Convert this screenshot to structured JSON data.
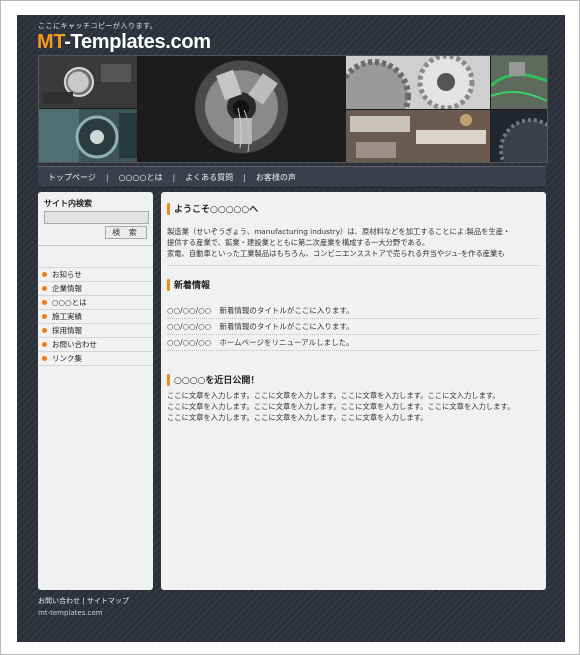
{
  "header": {
    "catch_copy": "ここにキャッチコピーが入ります。",
    "logo_accent": "MT",
    "logo_rest": "-Templates.com",
    "accent_color": "#f39a1d"
  },
  "nav": {
    "items": [
      "トップページ",
      "○○○○とは",
      "よくある質問",
      "お客様の声"
    ],
    "separator": "|"
  },
  "sidebar": {
    "search_title": "サイト内検索",
    "search_value": "",
    "search_button": "検 索",
    "menu": [
      "お知らせ",
      "企業情報",
      "○○○とは",
      "施工実績",
      "採用情報",
      "お問い合わせ",
      "リンク集"
    ]
  },
  "main": {
    "welcome_heading": "ようこそ○○○○○へ",
    "welcome_lines": [
      "製造業（せいぞうぎょう、manufacturing industry）は、原材料などを加工することによ:製品を生産・",
      "提供する産業で、鉱業・建設業とともに第二次産業を構成する一大分野である。",
      "家電、自動車といった工業製品はもちろん、コンビニエンスストアで売られる弁当やジュ-を作る産業も"
    ],
    "news_heading": "新着情報",
    "news": [
      {
        "date": "○○/○○/○○",
        "title": "新着情報のタイトルがここに入ります。"
      },
      {
        "date": "○○/○○/○○",
        "title": "新着情報のタイトルがここに入ります。"
      },
      {
        "date": "○○/○○/○○",
        "title": "ホームページをリニューアルしました。"
      }
    ],
    "soon_heading": "○○○○を近日公開！",
    "soon_lines": [
      "ここに文章を入力します。ここに文章を入力します。ここに文章を入力します。ここに文入力します。",
      "ここに文章を入力します。ここに文章を入力します。ここに文章を入力します。ここに文章を入力します。",
      "ここに文章を入力します。ここに文章を入力します。ここに文章を入力します。"
    ]
  },
  "footer": {
    "links": [
      "お問い合わせ",
      "サイトマップ"
    ],
    "link_separator": "|",
    "site": "mt-templates.com"
  }
}
